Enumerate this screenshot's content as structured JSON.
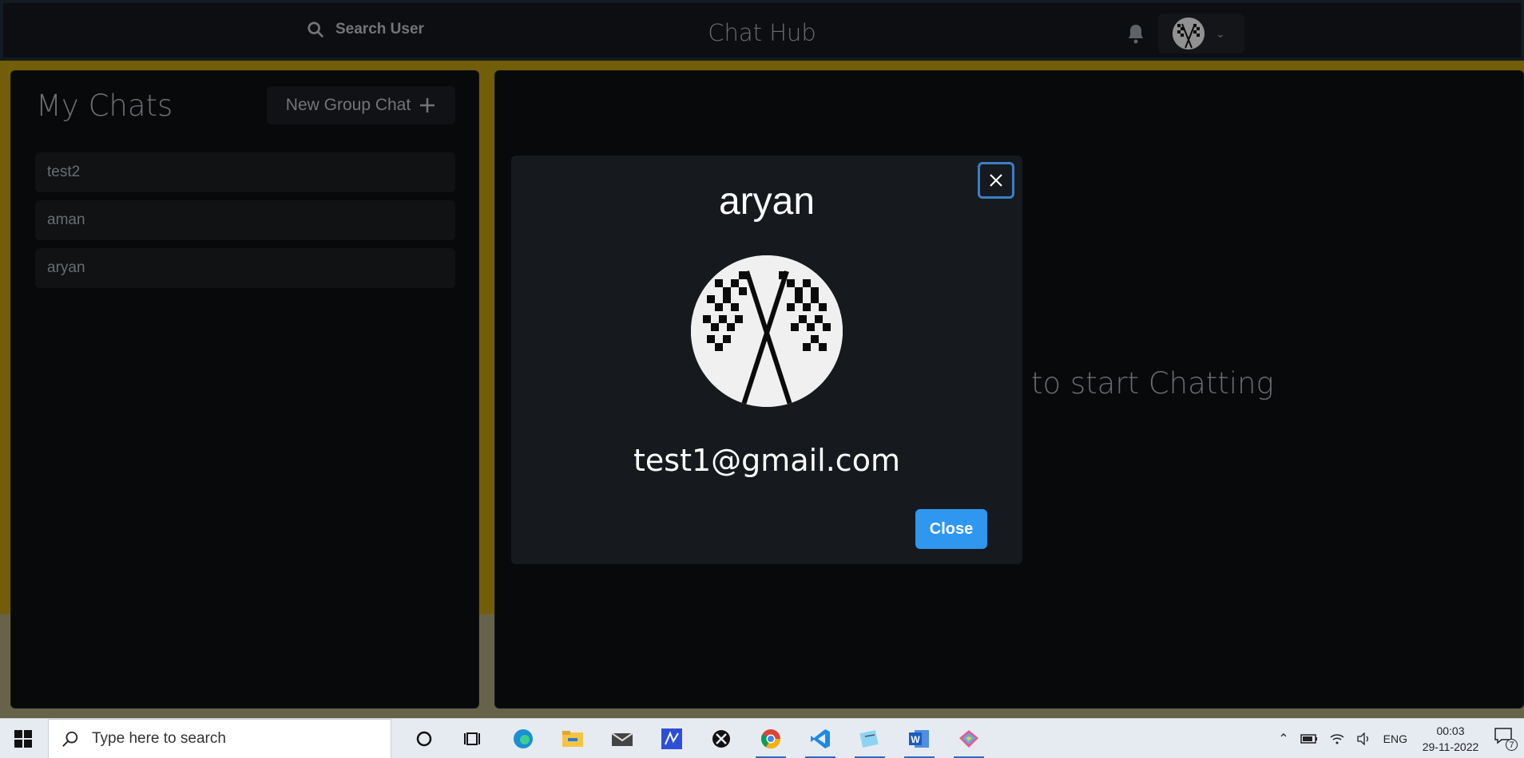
{
  "header": {
    "search_label": "Search User",
    "app_title": "Chat Hub"
  },
  "chats": {
    "title": "My Chats",
    "new_group_label": "New Group Chat",
    "items": [
      {
        "label": "test2"
      },
      {
        "label": "aman"
      },
      {
        "label": "aryan"
      }
    ]
  },
  "main": {
    "placeholder_text": "Click on a user to start Chatting"
  },
  "modal": {
    "name": "aryan",
    "email": "test1@gmail.com",
    "close_label": "Close"
  },
  "taskbar": {
    "search_placeholder": "Type here to search",
    "language": "ENG",
    "time": "00:03",
    "date": "29-11-2022",
    "notification_count": "7"
  },
  "colors": {
    "accent": "#2f97f0",
    "background": "#b8960f",
    "panel": "#0d0f12"
  }
}
